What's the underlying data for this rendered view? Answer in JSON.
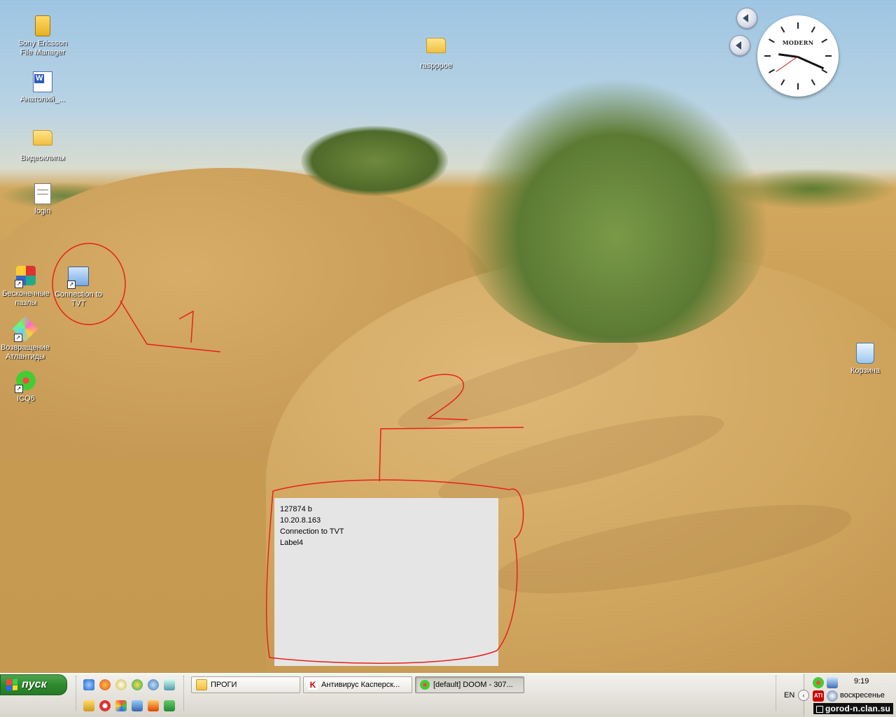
{
  "desktop": {
    "icons_left": [
      {
        "label": "Sony Ericsson File Manager"
      },
      {
        "label": "Анатолий_..."
      },
      {
        "label": "Видеоклипы"
      },
      {
        "label": "login"
      },
      {
        "label": "Бесконечные пазлы"
      },
      {
        "label": "Connection to TVT"
      },
      {
        "label": "Возвращение Атлантиды"
      },
      {
        "label": "ICQ6"
      }
    ],
    "icon_center": {
      "label": "raspppoe"
    },
    "icon_recycle": {
      "label": "Корзина"
    }
  },
  "clock_gadget": {
    "brand": "MODERN",
    "time_shown": "9:19"
  },
  "annotations": {
    "mark1": "1",
    "mark2": "2",
    "color": "#e8201a"
  },
  "label_panel": {
    "lines": [
      "127874 b",
      "10.20.8.163",
      "Connection to TVT",
      "Label4"
    ]
  },
  "taskbar": {
    "start_label": "пуск",
    "windows": [
      {
        "label": "ПРОГИ",
        "icon": "folder-icon"
      },
      {
        "label": "Антивирус Касперск...",
        "icon": "kaspersky-icon"
      },
      {
        "label": "[default] DOOM - 307...",
        "icon": "icq-icon"
      }
    ],
    "tray": {
      "language": "EN",
      "time": "9:19",
      "day": "воскресенье",
      "watermark": "gorod-n.clan.su"
    }
  }
}
